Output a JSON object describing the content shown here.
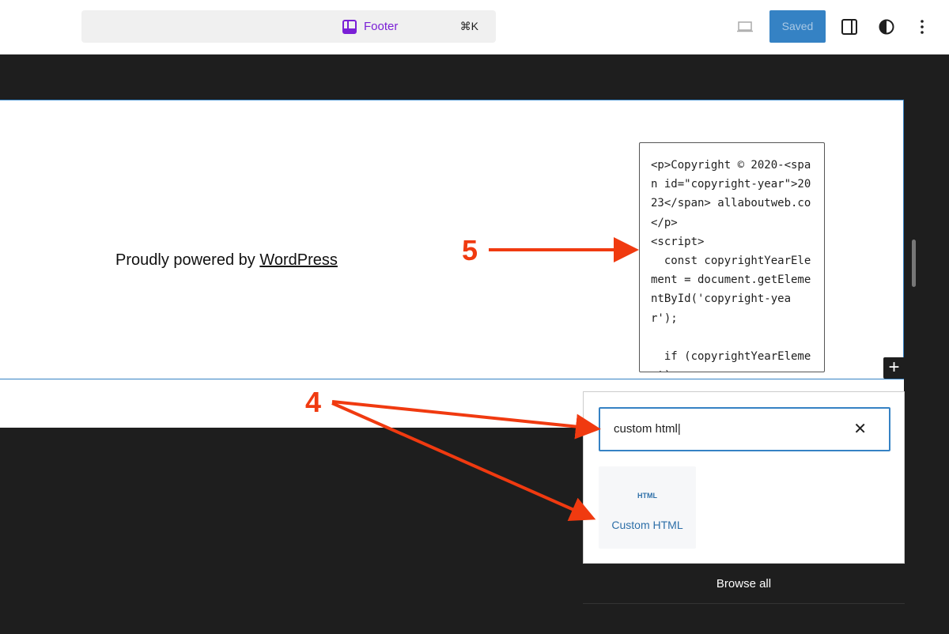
{
  "header": {
    "title": "Footer",
    "shortcut": "⌘K",
    "saved_label": "Saved"
  },
  "canvas": {
    "powered_prefix": "Proudly powered by ",
    "powered_link": "WordPress",
    "code": "<p>Copyright © 2020-<span id=\"copyright-year\">2023</span> allaboutweb.co</p>\n<script>\n  const copyrightYearElement = document.getElementById('copyright-year');\n\n  if (copyrightYearElement)"
  },
  "inserter": {
    "search_value": "custom html",
    "result_icon": "HTML",
    "result_label": "Custom HTML",
    "browse_all": "Browse all"
  },
  "annotations": {
    "step4": "4",
    "step5": "5"
  },
  "colors": {
    "accent": "#3582c4",
    "annotation": "#f03a10",
    "template": "#7a1fd6"
  }
}
